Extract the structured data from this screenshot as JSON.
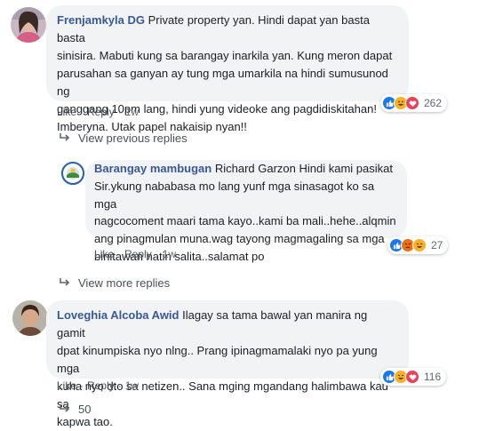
{
  "comments": [
    {
      "author": "Frenjamkyla DG",
      "lines": [
        "Private property yan. Hindi dapat yan basta basta",
        "sinisira. Mabuti kung sa barangay inarkila yan. Kung meron dapat",
        "parusahan sa ganyan ay tung mga umarkila na hindi sumusunod ng",
        "ganggang 10pm lang, hindi yung videoke ang pagdidiskitahan!",
        "Imberyna. Utak papel nakaisip nyan!!"
      ],
      "like": "Like",
      "reply": "Reply",
      "time": "1w",
      "reaction_count": "262"
    },
    {
      "author": "Barangay mambugan",
      "lines": [
        "Richard Garzon Hindi kami pasikat",
        "Sir.ykung nababasa mo lang yunf mga sinasagot ko sa mga",
        "nagcocoment maari tama kayo..kami ba mali..hehe..alqmin",
        "ang pinagmulan muna.wag tayong magmagaling sa mga",
        "binitawan natin salita..salamat po"
      ],
      "like": "Like",
      "reply": "Reply",
      "time": "1w",
      "reaction_count": "27"
    },
    {
      "author": "Loveghia Alcoba Awid",
      "lines": [
        "Ilagay sa tama bawal yan manira ng gamit",
        "dpat kinumpiska nyo nlng.. Prang ipinagmamalaki nyo pa yung mga",
        "kuha nyo dto sa netizen.. Sana mging mgandang halimbawa kau sa",
        "kapwa tao."
      ],
      "like": "Like",
      "reply": "Reply",
      "time": "1w",
      "reaction_count": "116"
    }
  ],
  "view_previous_replies": "View previous replies",
  "view_more_replies": "View more replies",
  "partial_footer_count": "50",
  "colors": {
    "link": "#385898",
    "bubble": "#f2f3f5",
    "like": "#1877f2",
    "haha": "#f7b125",
    "love": "#f33e58",
    "angry": "#e9710f"
  }
}
